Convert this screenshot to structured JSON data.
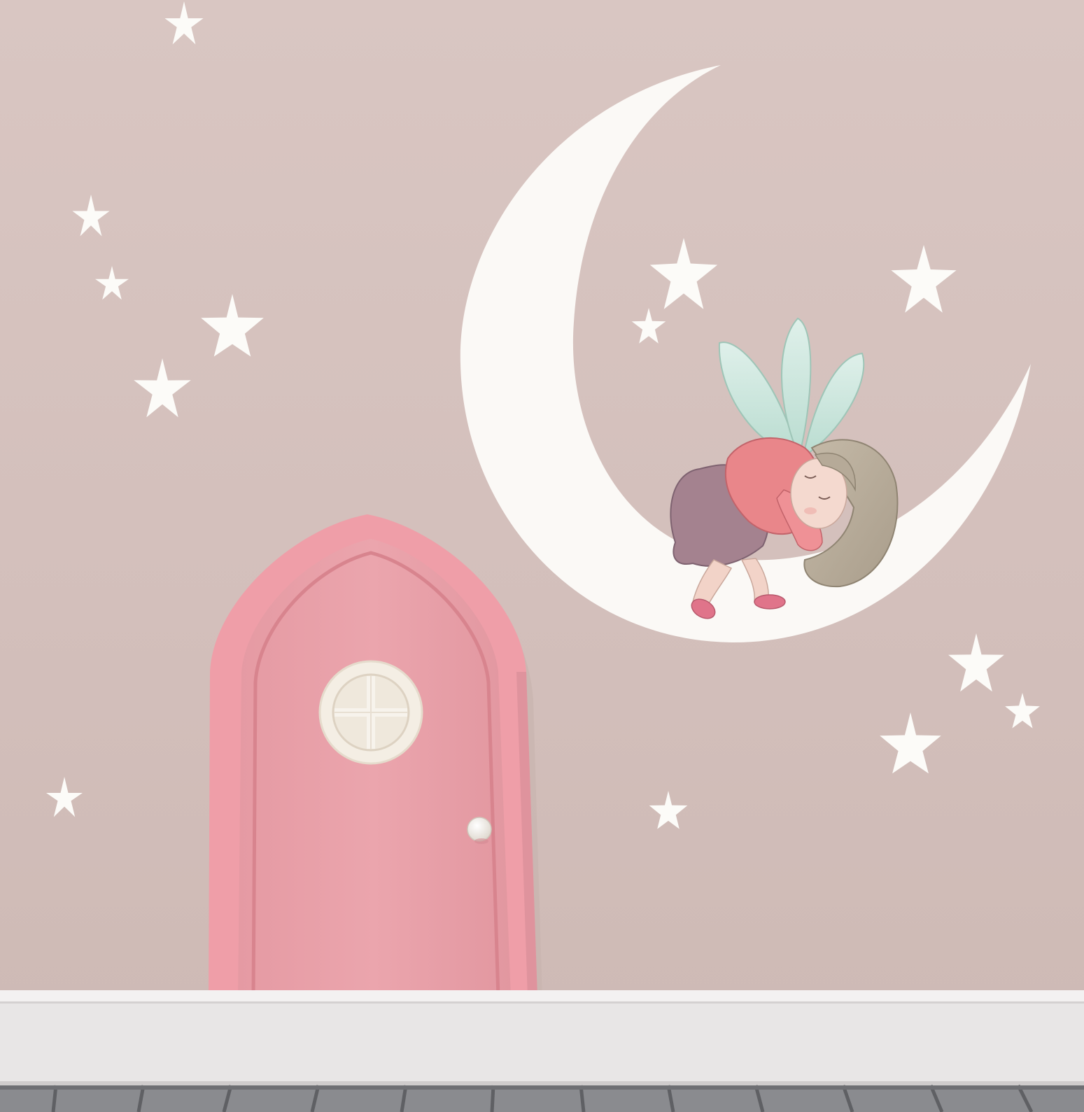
{
  "scene": {
    "subject": "nursery-wall-decor",
    "colors": {
      "wall": "#d6c3bf",
      "moon": "#fbf9f6",
      "star": "#fcfbf8",
      "door": "#eaa3ab",
      "door_shade": "#d9868f",
      "door_frame": "#f0aab2",
      "window_ring": "#f4eee4",
      "baseboard": "#e9e6e6",
      "floor": "#8b8c90",
      "fairy_wings": "#c9e6dc",
      "fairy_top": "#e9868a",
      "fairy_skirt": "#a07f8e",
      "fairy_hair": "#b6aa98",
      "fairy_skin": "#f2d3c8",
      "fairy_shoes": "#e0748a"
    },
    "elements": [
      "crescent-moon",
      "sleeping-fairy",
      "fairy-door",
      "round-window",
      "door-knob",
      "wall-stars",
      "baseboard",
      "floorboards"
    ]
  }
}
